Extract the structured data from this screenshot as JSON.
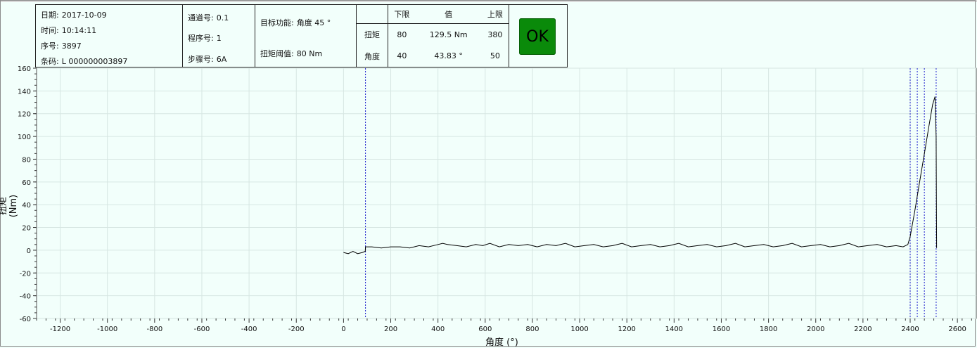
{
  "info": {
    "date_label": "日期:",
    "date_value": "2017-10-09",
    "time_label": "时间:",
    "time_value": "10:14:11",
    "seq_label": "序号:",
    "seq_value": "3897",
    "barcode_label": "条码:",
    "barcode_value": "L 000000003897",
    "channel_label": "通道号:",
    "channel_value": "0.1",
    "program_label": "程序号:",
    "program_value": "1",
    "step_label": "步骤号:",
    "step_value": "6A",
    "target_label": "目标功能:",
    "target_value": "角度  45 °",
    "threshold_label": "扭矩阈值:",
    "threshold_value": "80  Nm"
  },
  "limits": {
    "headers": [
      "下限",
      "值",
      "上限"
    ],
    "rows": [
      {
        "name": "扭矩",
        "lower": "80",
        "value": "129.5 Nm",
        "upper": "380"
      },
      {
        "name": "角度",
        "lower": "40",
        "value": "43.83 °",
        "upper": "50"
      }
    ]
  },
  "status": {
    "label": "OK",
    "color": "#0a8a0a"
  },
  "chart_data": {
    "type": "line",
    "xlabel": "角度 (°)",
    "ylabel": "扭矩 (Nm)",
    "xlim": [
      -1300,
      2680
    ],
    "ylim": [
      -60,
      160
    ],
    "xticks": [
      -1200,
      -1000,
      -800,
      -600,
      -400,
      -200,
      0,
      200,
      400,
      600,
      800,
      1000,
      1200,
      1400,
      1600,
      1800,
      2000,
      2200,
      2400,
      2600
    ],
    "yticks": [
      -60,
      -40,
      -20,
      0,
      20,
      40,
      60,
      80,
      100,
      120,
      140,
      160
    ],
    "grid": true,
    "vertical_markers": [
      93,
      2400,
      2430,
      2460,
      2510
    ],
    "series": [
      {
        "x": [
          0,
          20,
          40,
          60,
          80,
          92,
          93,
          120,
          160,
          200,
          240,
          280,
          320,
          360,
          400,
          420,
          440,
          480,
          520,
          560,
          590,
          620,
          660,
          700,
          740,
          780,
          820,
          860,
          900,
          940,
          980,
          1020,
          1060,
          1100,
          1140,
          1180,
          1220,
          1260,
          1300,
          1340,
          1380,
          1420,
          1460,
          1500,
          1540,
          1580,
          1620,
          1660,
          1700,
          1740,
          1780,
          1820,
          1860,
          1900,
          1940,
          1980,
          2020,
          2060,
          2100,
          2140,
          2180,
          2220,
          2260,
          2300,
          2340,
          2370,
          2390,
          2400,
          2420,
          2440,
          2460,
          2480,
          2495,
          2505,
          2510,
          2512
        ],
        "y": [
          -2,
          -3,
          -1,
          -3,
          -2,
          -1,
          3,
          3,
          2,
          3,
          3,
          2,
          4,
          3,
          5,
          6,
          5,
          4,
          3,
          5,
          4,
          6,
          3,
          5,
          4,
          5,
          3,
          5,
          4,
          6,
          3,
          4,
          5,
          3,
          4,
          6,
          3,
          4,
          5,
          3,
          4,
          6,
          3,
          4,
          5,
          3,
          4,
          6,
          3,
          4,
          5,
          3,
          4,
          6,
          3,
          4,
          5,
          3,
          4,
          6,
          3,
          4,
          5,
          3,
          4,
          3,
          5,
          12,
          35,
          60,
          85,
          110,
          128,
          135,
          100,
          2
        ],
        "color": "#000000"
      }
    ]
  }
}
